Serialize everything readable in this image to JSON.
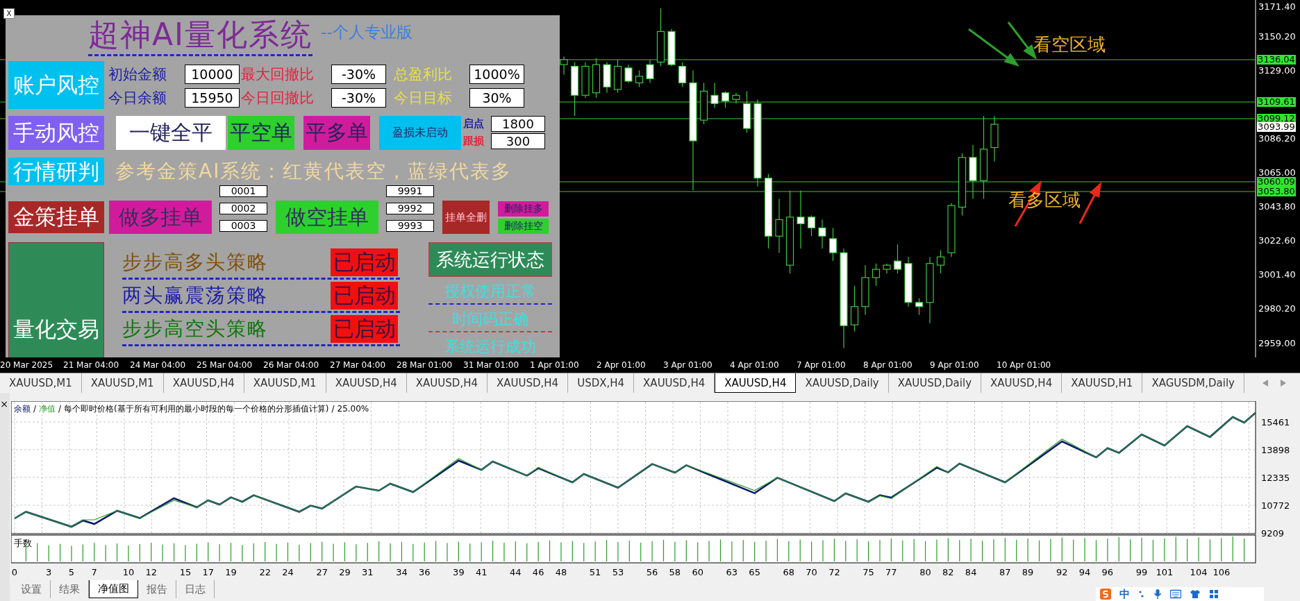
{
  "chart_window": {
    "close": "X",
    "annotations": [
      {
        "text": "看空区域",
        "kind": "bearish"
      },
      {
        "text": "看多区域",
        "kind": "bullish"
      }
    ],
    "price_ticks": [
      "3171.40",
      "3150.20",
      "3129.00",
      "3086.20",
      "3065.00",
      "3043.80",
      "3022.60",
      "3001.40",
      "2980.20",
      "2959.00"
    ],
    "price_tags": [
      {
        "text": "3136.04",
        "kind": "line"
      },
      {
        "text": "3109.61",
        "kind": "line"
      },
      {
        "text": "3099.12",
        "kind": "line"
      },
      {
        "text": "3093.99",
        "kind": "bid"
      },
      {
        "text": "3060.09",
        "kind": "line"
      },
      {
        "text": "3053.80",
        "kind": "line"
      }
    ],
    "time_labels": [
      "20 Mar 2025",
      "21 Mar 04:00",
      "24 Mar 04:00",
      "25 Mar 04:00",
      "26 Mar 04:00",
      "27 Mar 04:00",
      "28 Mar 01:00",
      "31 Mar 01:00",
      "1 Apr 01:00",
      "2 Apr 01:00",
      "3 Apr 01:00",
      "4 Apr 01:00",
      "7 Apr 01:00",
      "8 Apr 01:00",
      "9 Apr 01:00",
      "10 Apr 01:00"
    ]
  },
  "panel": {
    "title": "超神AI量化系统",
    "subtitle": "--个人专业版",
    "account": {
      "button": "账户风控",
      "fields": [
        {
          "label": "初始金额",
          "value": "10000",
          "color": "#1c1ca8"
        },
        {
          "label": "最大回撤比",
          "value": "-30%",
          "color": "#e8203c"
        },
        {
          "label": "总盈利比",
          "value": "1000%",
          "color": "#e8e048"
        },
        {
          "label": "今日余额",
          "value": "15950",
          "color": "#1c1ca8"
        },
        {
          "label": "今日回撤比",
          "value": "-30%",
          "color": "#e8203c"
        },
        {
          "label": "今日目标",
          "value": "30%",
          "color": "#e8e048"
        }
      ]
    },
    "manual": {
      "button": "手动风控",
      "actions": [
        {
          "label": "一键全平",
          "color": "#ffffff"
        },
        {
          "label": "平空单",
          "color": "#2ed02e"
        },
        {
          "label": "平多单",
          "color": "#d01c9c"
        },
        {
          "label": "盈损未启动",
          "color": "#00c0f0"
        }
      ],
      "trail": [
        {
          "label": "启点",
          "value": "1800",
          "color": "#1c1ca8"
        },
        {
          "label": "跟损",
          "value": "300",
          "color": "#e8203c"
        }
      ]
    },
    "research": {
      "button": "行情研判",
      "note": "参考金策AI系统：红黄代表空，蓝绿代表多"
    },
    "pending": {
      "button": "金策挂单",
      "long": {
        "label": "做多挂单",
        "ids": [
          "0001",
          "0002",
          "0003"
        ]
      },
      "short": {
        "label": "做空挂单",
        "ids": [
          "9991",
          "9992",
          "9993"
        ]
      },
      "delete_all": "挂单全删",
      "delete_long": "删除挂多",
      "delete_short": "删除挂空"
    },
    "quant": {
      "button": "量化交易",
      "strategies": [
        {
          "name": "步步高多头策略",
          "status": "已启动",
          "color": "#80500c"
        },
        {
          "name": "两头赢震荡策略",
          "status": "已启动",
          "color": "#1c1ca8"
        },
        {
          "name": "步步高空头策略",
          "status": "已启动",
          "color": "#0c760c"
        }
      ],
      "status_button": "系统运行状态",
      "status_lines": [
        "授权使用正常",
        "时间码正确",
        "系统运行成功"
      ]
    }
  },
  "symbol_tabs": [
    {
      "label": "XAUUSD,M1",
      "selected": false
    },
    {
      "label": "XAUUSD,M1",
      "selected": false
    },
    {
      "label": "XAUUSD,H4",
      "selected": false
    },
    {
      "label": "XAUUSD,M1",
      "selected": false
    },
    {
      "label": "XAUUSD,H4",
      "selected": false
    },
    {
      "label": "XAUUSD,H4",
      "selected": false
    },
    {
      "label": "XAUUSD,H4",
      "selected": false
    },
    {
      "label": "USDX,H4",
      "selected": false
    },
    {
      "label": "XAUUSD,H4",
      "selected": false
    },
    {
      "label": "XAUUSD,H4",
      "selected": true
    },
    {
      "label": "XAUUSD,Daily",
      "selected": false
    },
    {
      "label": "XAUUSD,Daily",
      "selected": false
    },
    {
      "label": "XAUUSD,H4",
      "selected": false
    },
    {
      "label": "XAUUSD,H1",
      "selected": false
    },
    {
      "label": "XAGUSDM,Daily",
      "selected": false
    }
  ],
  "tester": {
    "close": "×",
    "legend": {
      "separator": "/",
      "note": "每个即时价格(基于所有可利用的最小时段的每一个价格的分形插值计算)",
      "percent": "25.00%"
    },
    "chart_data": {
      "type": "line",
      "x": [
        0,
        1,
        5,
        6,
        7,
        9,
        11,
        14,
        16,
        17,
        18,
        19,
        20,
        21,
        25,
        26,
        27,
        30,
        32,
        33,
        35,
        39,
        41,
        42,
        45,
        46,
        49,
        50,
        53,
        56,
        58,
        59,
        65,
        67,
        72,
        73,
        75,
        76,
        77,
        81,
        82,
        83,
        87,
        92,
        95,
        96,
        97,
        99,
        101,
        103,
        105,
        107,
        108,
        109
      ],
      "series": [
        {
          "name": "余额",
          "color": "#0a1a6a",
          "values": [
            10030,
            10401,
            9561,
            9912,
            9717,
            10459,
            10049,
            11163,
            10655,
            11046,
            10811,
            11217,
            10967,
            11334,
            10401,
            10748,
            10584,
            11827,
            11592,
            11983,
            11514,
            13281,
            12764,
            13234,
            12437,
            12859,
            12062,
            12530,
            11756,
            13093,
            12608,
            13023,
            11452,
            12320,
            11007,
            11436,
            10967,
            11334,
            11202,
            12884,
            12624,
            13117,
            12062,
            14368,
            13470,
            13984,
            13726,
            14758,
            14133,
            15227,
            14617,
            15742,
            15422,
            15977
          ]
        },
        {
          "name": "净值",
          "color": "#2a9a2a",
          "values": [
            10030,
            10401,
            9561,
            9950,
            9950,
            10459,
            10049,
            11050,
            10655,
            11046,
            10811,
            11217,
            10967,
            11334,
            10401,
            10748,
            10584,
            11827,
            11592,
            11983,
            11514,
            13400,
            12764,
            13234,
            12437,
            12900,
            12062,
            12530,
            11756,
            13093,
            12608,
            13023,
            11600,
            12320,
            11007,
            11436,
            10967,
            11300,
            11150,
            12950,
            12624,
            13117,
            12062,
            14500,
            13470,
            13984,
            13726,
            14758,
            14133,
            15227,
            14617,
            15742,
            15422,
            15977
          ]
        }
      ],
      "xlim": [
        0,
        109
      ],
      "ylim": [
        9209,
        16516
      ],
      "xticks": [
        0,
        3,
        5,
        7,
        10,
        12,
        15,
        17,
        19,
        22,
        24,
        27,
        29,
        31,
        34,
        36,
        39,
        41,
        44,
        46,
        48,
        51,
        53,
        56,
        58,
        60,
        63,
        65,
        68,
        70,
        72,
        75,
        77,
        80,
        82,
        84,
        87,
        89,
        92,
        94,
        96,
        99,
        101,
        104,
        106
      ],
      "yticks": [
        9209,
        10772,
        12335,
        13898,
        15461
      ],
      "grid": true
    },
    "lots_label": "手数",
    "tabs": [
      {
        "label": "设置",
        "selected": false
      },
      {
        "label": "结果",
        "selected": false
      },
      {
        "label": "净值图",
        "selected": true
      },
      {
        "label": "报告",
        "selected": false
      },
      {
        "label": "日志",
        "selected": false
      }
    ]
  },
  "ime_bar": {
    "mode": "中"
  }
}
